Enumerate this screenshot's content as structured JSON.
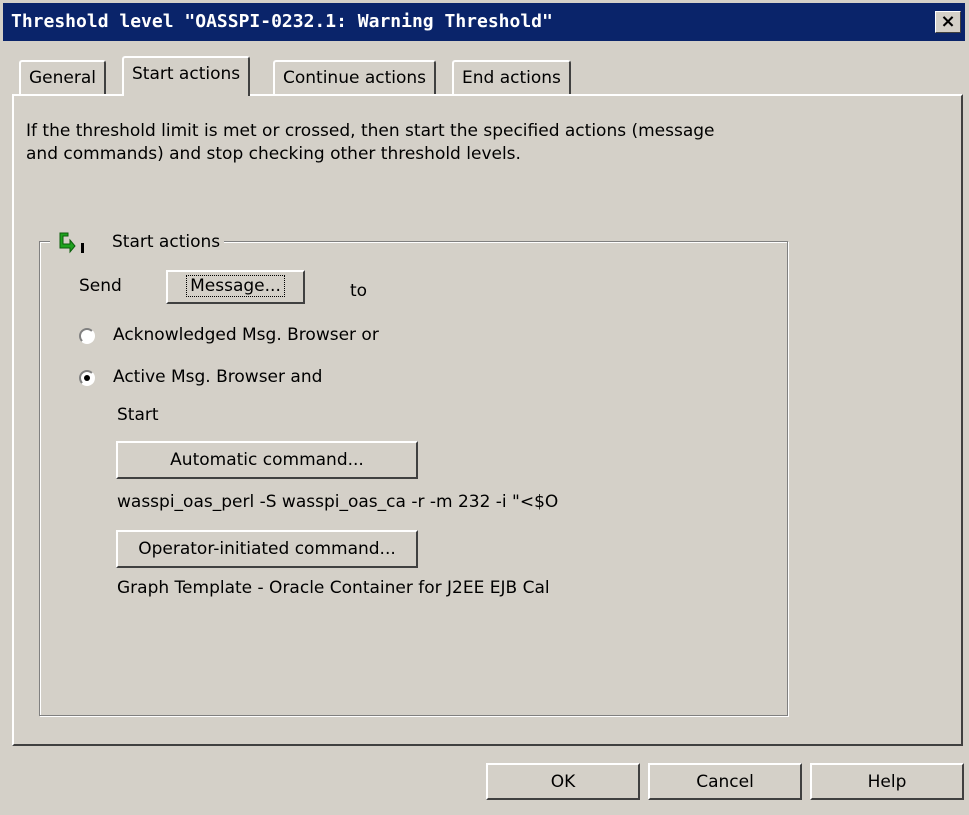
{
  "window": {
    "title": "Threshold level \"OASSPI-0232.1: Warning Threshold\"",
    "close_label": "×"
  },
  "tabs": [
    {
      "label": "General",
      "active": false
    },
    {
      "label": "Start actions",
      "active": true
    },
    {
      "label": "Continue actions",
      "active": false
    },
    {
      "label": "End actions",
      "active": false
    }
  ],
  "description": "If the threshold limit is met or crossed, then start the specified actions (message\nand commands) and stop checking other threshold levels.",
  "start_actions": {
    "group_label": "Start actions",
    "send_label": "Send",
    "message_button": "Message...",
    "to_label": "to",
    "radio_acknowledged": {
      "label": "Acknowledged Msg. Browser or",
      "selected": false
    },
    "radio_active": {
      "label": "Active Msg. Browser and",
      "selected": true
    },
    "start_label": "Start",
    "automatic_command_button": "Automatic command...",
    "automatic_command_value": "wasspi_oas_perl -S wasspi_oas_ca -r -m 232 -i \"<$O",
    "operator_command_button": "Operator-initiated command...",
    "operator_command_value": "Graph Template - Oracle Container for J2EE EJB Cal"
  },
  "footer": {
    "ok": "OK",
    "cancel": "Cancel",
    "help": "Help"
  },
  "icons": {
    "start_actions_icon": "green-arrow-icon"
  }
}
